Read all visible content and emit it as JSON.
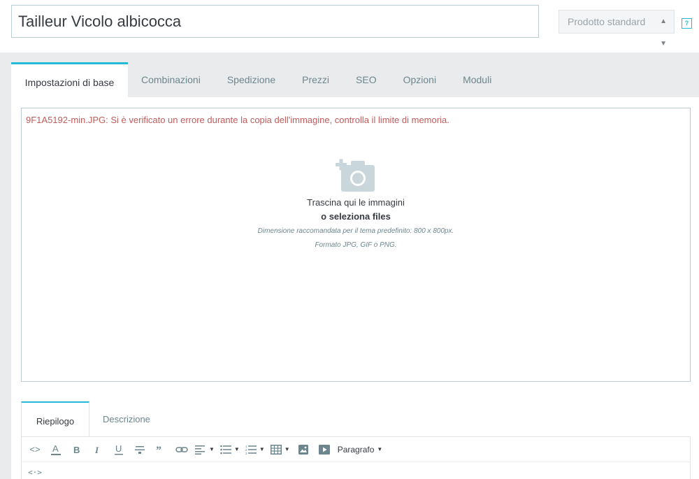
{
  "product": {
    "name": "Tailleur Vicolo albicocca",
    "type_select": "Prodotto standard",
    "help_icon": "?"
  },
  "main_tabs": [
    {
      "label": "Impostazioni di base",
      "active": true
    },
    {
      "label": "Combinazioni"
    },
    {
      "label": "Spedizione"
    },
    {
      "label": "Prezzi"
    },
    {
      "label": "SEO"
    },
    {
      "label": "Opzioni"
    },
    {
      "label": "Moduli"
    }
  ],
  "dropzone": {
    "error": "9F1A5192-min.JPG: Si è verificato un errore durante la copia dell'immagine, controlla il limite di memoria.",
    "line1": "Trascina qui le immagini",
    "line2": "o seleziona files",
    "line3": "Dimensione raccomandata per il tema predefinito: 800 x 800px.",
    "line4": "Formato JPG, GIF o PNG.",
    "icon": "add-photo-icon"
  },
  "sub_tabs": [
    {
      "label": "Riepilogo",
      "active": true
    },
    {
      "label": "Descrizione"
    }
  ],
  "editor": {
    "toolbar": {
      "source_icon": "<>",
      "paragraph_label": "Paragrafo"
    },
    "body_text": "<·>"
  },
  "colors": {
    "accent": "#25b9d7",
    "error": "#c05c5c",
    "gray_band": "#eaebec"
  }
}
